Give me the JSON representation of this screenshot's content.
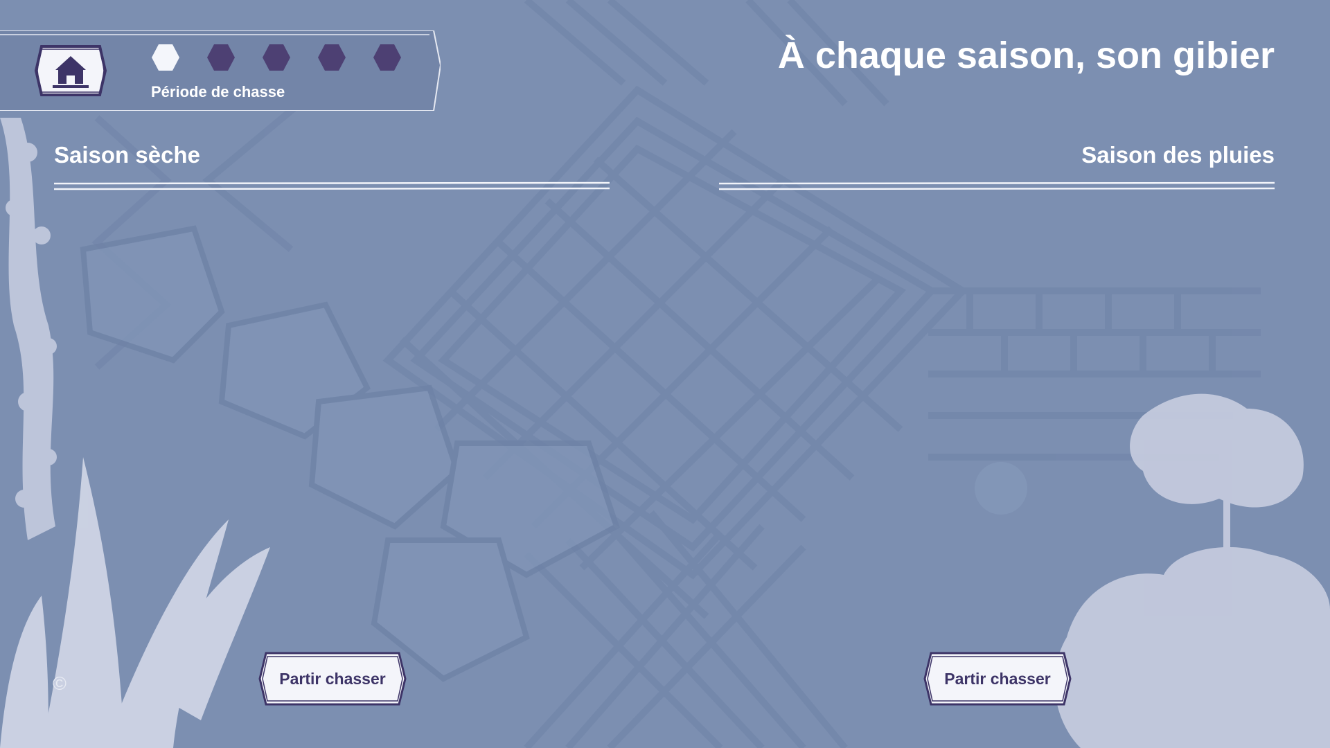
{
  "header": {
    "title": "À chaque saison, son gibier",
    "home_icon": "home-icon",
    "progress_label": "Période de chasse",
    "progress": {
      "current_step": 1,
      "total_steps": 5
    }
  },
  "seasons": [
    {
      "title": "Saison sèche",
      "action_label": "Partir chasser"
    },
    {
      "title": "Saison des pluies",
      "action_label": "Partir chasser"
    }
  ],
  "footer": {
    "copyright": "©"
  },
  "colors": {
    "background": "#7c8fb1",
    "accent_dark": "#3d3467",
    "step_active": "#f4f6fb",
    "step_inactive": "#4d4073",
    "text": "#ffffff"
  }
}
